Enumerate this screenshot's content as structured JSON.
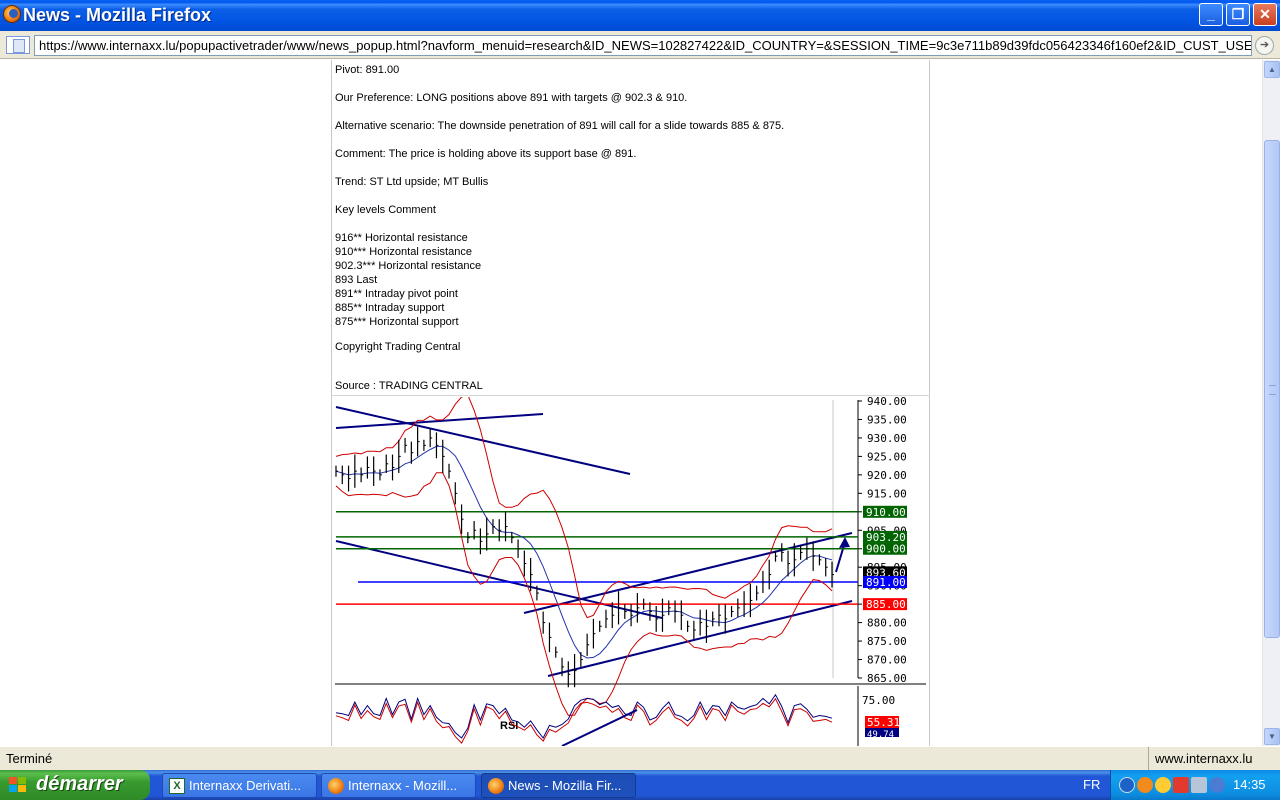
{
  "window": {
    "title": "News - Mozilla Firefox",
    "minimize": "_",
    "maximize": "❐",
    "close": "✕"
  },
  "address": {
    "url": "https://www.internaxx.lu/popupactivetrader/www/news_popup.html?navform_menuid=research&ID_NEWS=102827422&ID_COUNTRY=&SESSION_TIME=9c3e711b89d39fdc056423346f160ef2&ID_CUST_USER=e"
  },
  "article": {
    "pivot": "Pivot: 891.00",
    "preference": "Our Preference: LONG positions above 891 with targets @ 902.3 & 910.",
    "alternative": "Alternative scenario: The downside penetration of 891 will call for a slide towards 885 & 875.",
    "comment": "Comment: The price is holding above its support base @ 891.",
    "trend": "Trend: ST Ltd upside; MT Bullis",
    "key_levels_header": "Key levels Comment",
    "levels": [
      "916** Horizontal resistance",
      "910*** Horizontal resistance",
      "902.3*** Horizontal resistance",
      "893 Last",
      "891** Intraday pivot point",
      "885** Intraday support",
      "875*** Horizontal support"
    ],
    "copyright": "Copyright Trading Central",
    "source": "Source : TRADING CENTRAL"
  },
  "chart_data": {
    "type": "line",
    "y_ticks": [
      "940.00",
      "935.00",
      "930.00",
      "925.00",
      "920.00",
      "915.00",
      "910.00",
      "905.00",
      "900.00",
      "895.00",
      "890.00",
      "885.00",
      "880.00",
      "875.00",
      "870.00",
      "865.00"
    ],
    "ylim": [
      865,
      940
    ],
    "level_labels": [
      {
        "label": "910.00",
        "value": 910,
        "color": "#006400"
      },
      {
        "label": "903.20",
        "value": 903.2,
        "color": "#006400"
      },
      {
        "label": "900.00",
        "value": 900,
        "color": "#006400"
      },
      {
        "label": "893.60",
        "value": 893.6,
        "color": "#000000"
      },
      {
        "label": "891.00",
        "value": 891,
        "color": "#0000ff"
      },
      {
        "label": "885.00",
        "value": 885,
        "color": "#ff0000"
      }
    ],
    "price_series": [
      921,
      920,
      919,
      921,
      920,
      922,
      921,
      920,
      923,
      922,
      925,
      928,
      926,
      929,
      928,
      930,
      928,
      925,
      921,
      915,
      908,
      903,
      905,
      902,
      904,
      906,
      905,
      906,
      903,
      900,
      896,
      893,
      888,
      880,
      876,
      872,
      868,
      866,
      867,
      870,
      874,
      877,
      879,
      881,
      882,
      884,
      883,
      882,
      884,
      885,
      883,
      881,
      882,
      884,
      883,
      882,
      879,
      878,
      880,
      879,
      881,
      882,
      881,
      883,
      884,
      885,
      886,
      888,
      891,
      893,
      898,
      899,
      896,
      897,
      899,
      900,
      898,
      897,
      895,
      893
    ],
    "rsi_panel": {
      "label": "RSI",
      "y_ticks": [
        "75.00"
      ],
      "values": [
        "55.31",
        "49.74"
      ],
      "value_colors": [
        "#ff0000",
        "#000080"
      ]
    }
  },
  "status": {
    "left": "Terminé",
    "right": "www.internaxx.lu"
  },
  "taskbar": {
    "start": "démarrer",
    "tasks": [
      "Internaxx Derivati...",
      "Internaxx - Mozill...",
      "News - Mozilla Fir..."
    ],
    "lang": "FR",
    "clock": "14:35"
  }
}
